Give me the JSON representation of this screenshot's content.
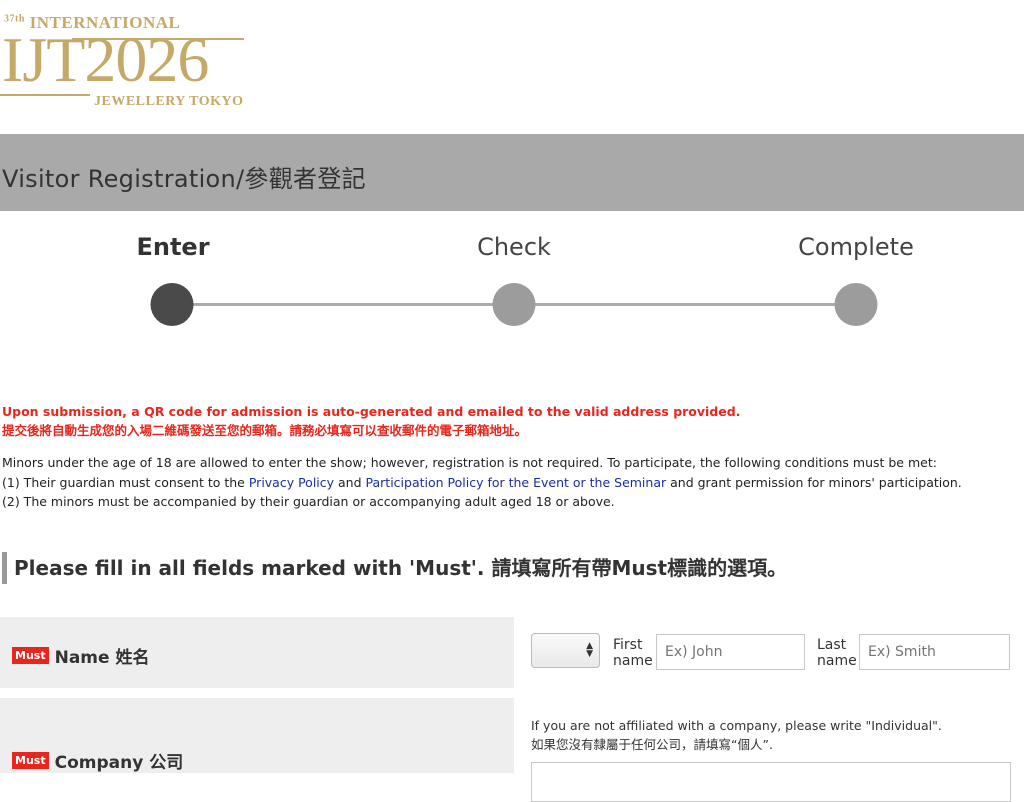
{
  "logo": {
    "edition": "37th",
    "top_text": "INTERNATIONAL",
    "main_text": "IJT2026",
    "bottom_text": "JEWELLERY TOKYO"
  },
  "page_title": "Visitor Registration/參觀者登記",
  "steps": [
    {
      "label": "Enter",
      "active": true
    },
    {
      "label": "Check",
      "active": false
    },
    {
      "label": "Complete",
      "active": false
    }
  ],
  "notice": {
    "red_en": "Upon submission, a QR code for admission is auto-generated and emailed to the valid address provided.",
    "red_zh": "提交後將自動生成您的入場二維碼發送至您的郵箱。請務必填寫可以查收郵件的電子郵箱地址。",
    "minors_intro": "Minors under the age of 18 are allowed to enter the show; however, registration is not required. To participate, the following conditions must be met:",
    "cond1_prefix": "(1) Their guardian must consent to the ",
    "privacy_link": "Privacy Policy",
    "cond1_and": " and ",
    "participation_link": "Participation Policy for the Event or the Seminar",
    "cond1_suffix": " and grant permission for minors' participation.",
    "cond2": "(2) The minors must be accompanied by their guardian or accompanying adult aged 18 or above."
  },
  "section_heading": "Please fill in all fields marked with 'Must'. 請填寫所有帶Must標識的選項。",
  "must_badge": "Must",
  "form": {
    "name_row": {
      "label": "Name 姓名",
      "first_label_1": "First",
      "first_label_2": "name",
      "first_placeholder": "Ex) John",
      "last_label_1": "Last",
      "last_label_2": "name",
      "last_placeholder": "Ex) Smith"
    },
    "company_row": {
      "label": "Company 公司",
      "hint_en": "If you are not affiliated with a company, please write \"Individual\".",
      "hint_zh": "如果您沒有隸屬于任何公司，請填寫“個人”."
    }
  },
  "colors": {
    "logo_gold": "#c5a968",
    "title_bar": "#a9a9a9",
    "must_red": "#e8261d",
    "link_blue": "#1a2f9c",
    "active_step": "#4a4a4a",
    "inactive_step": "#9c9c9c"
  }
}
